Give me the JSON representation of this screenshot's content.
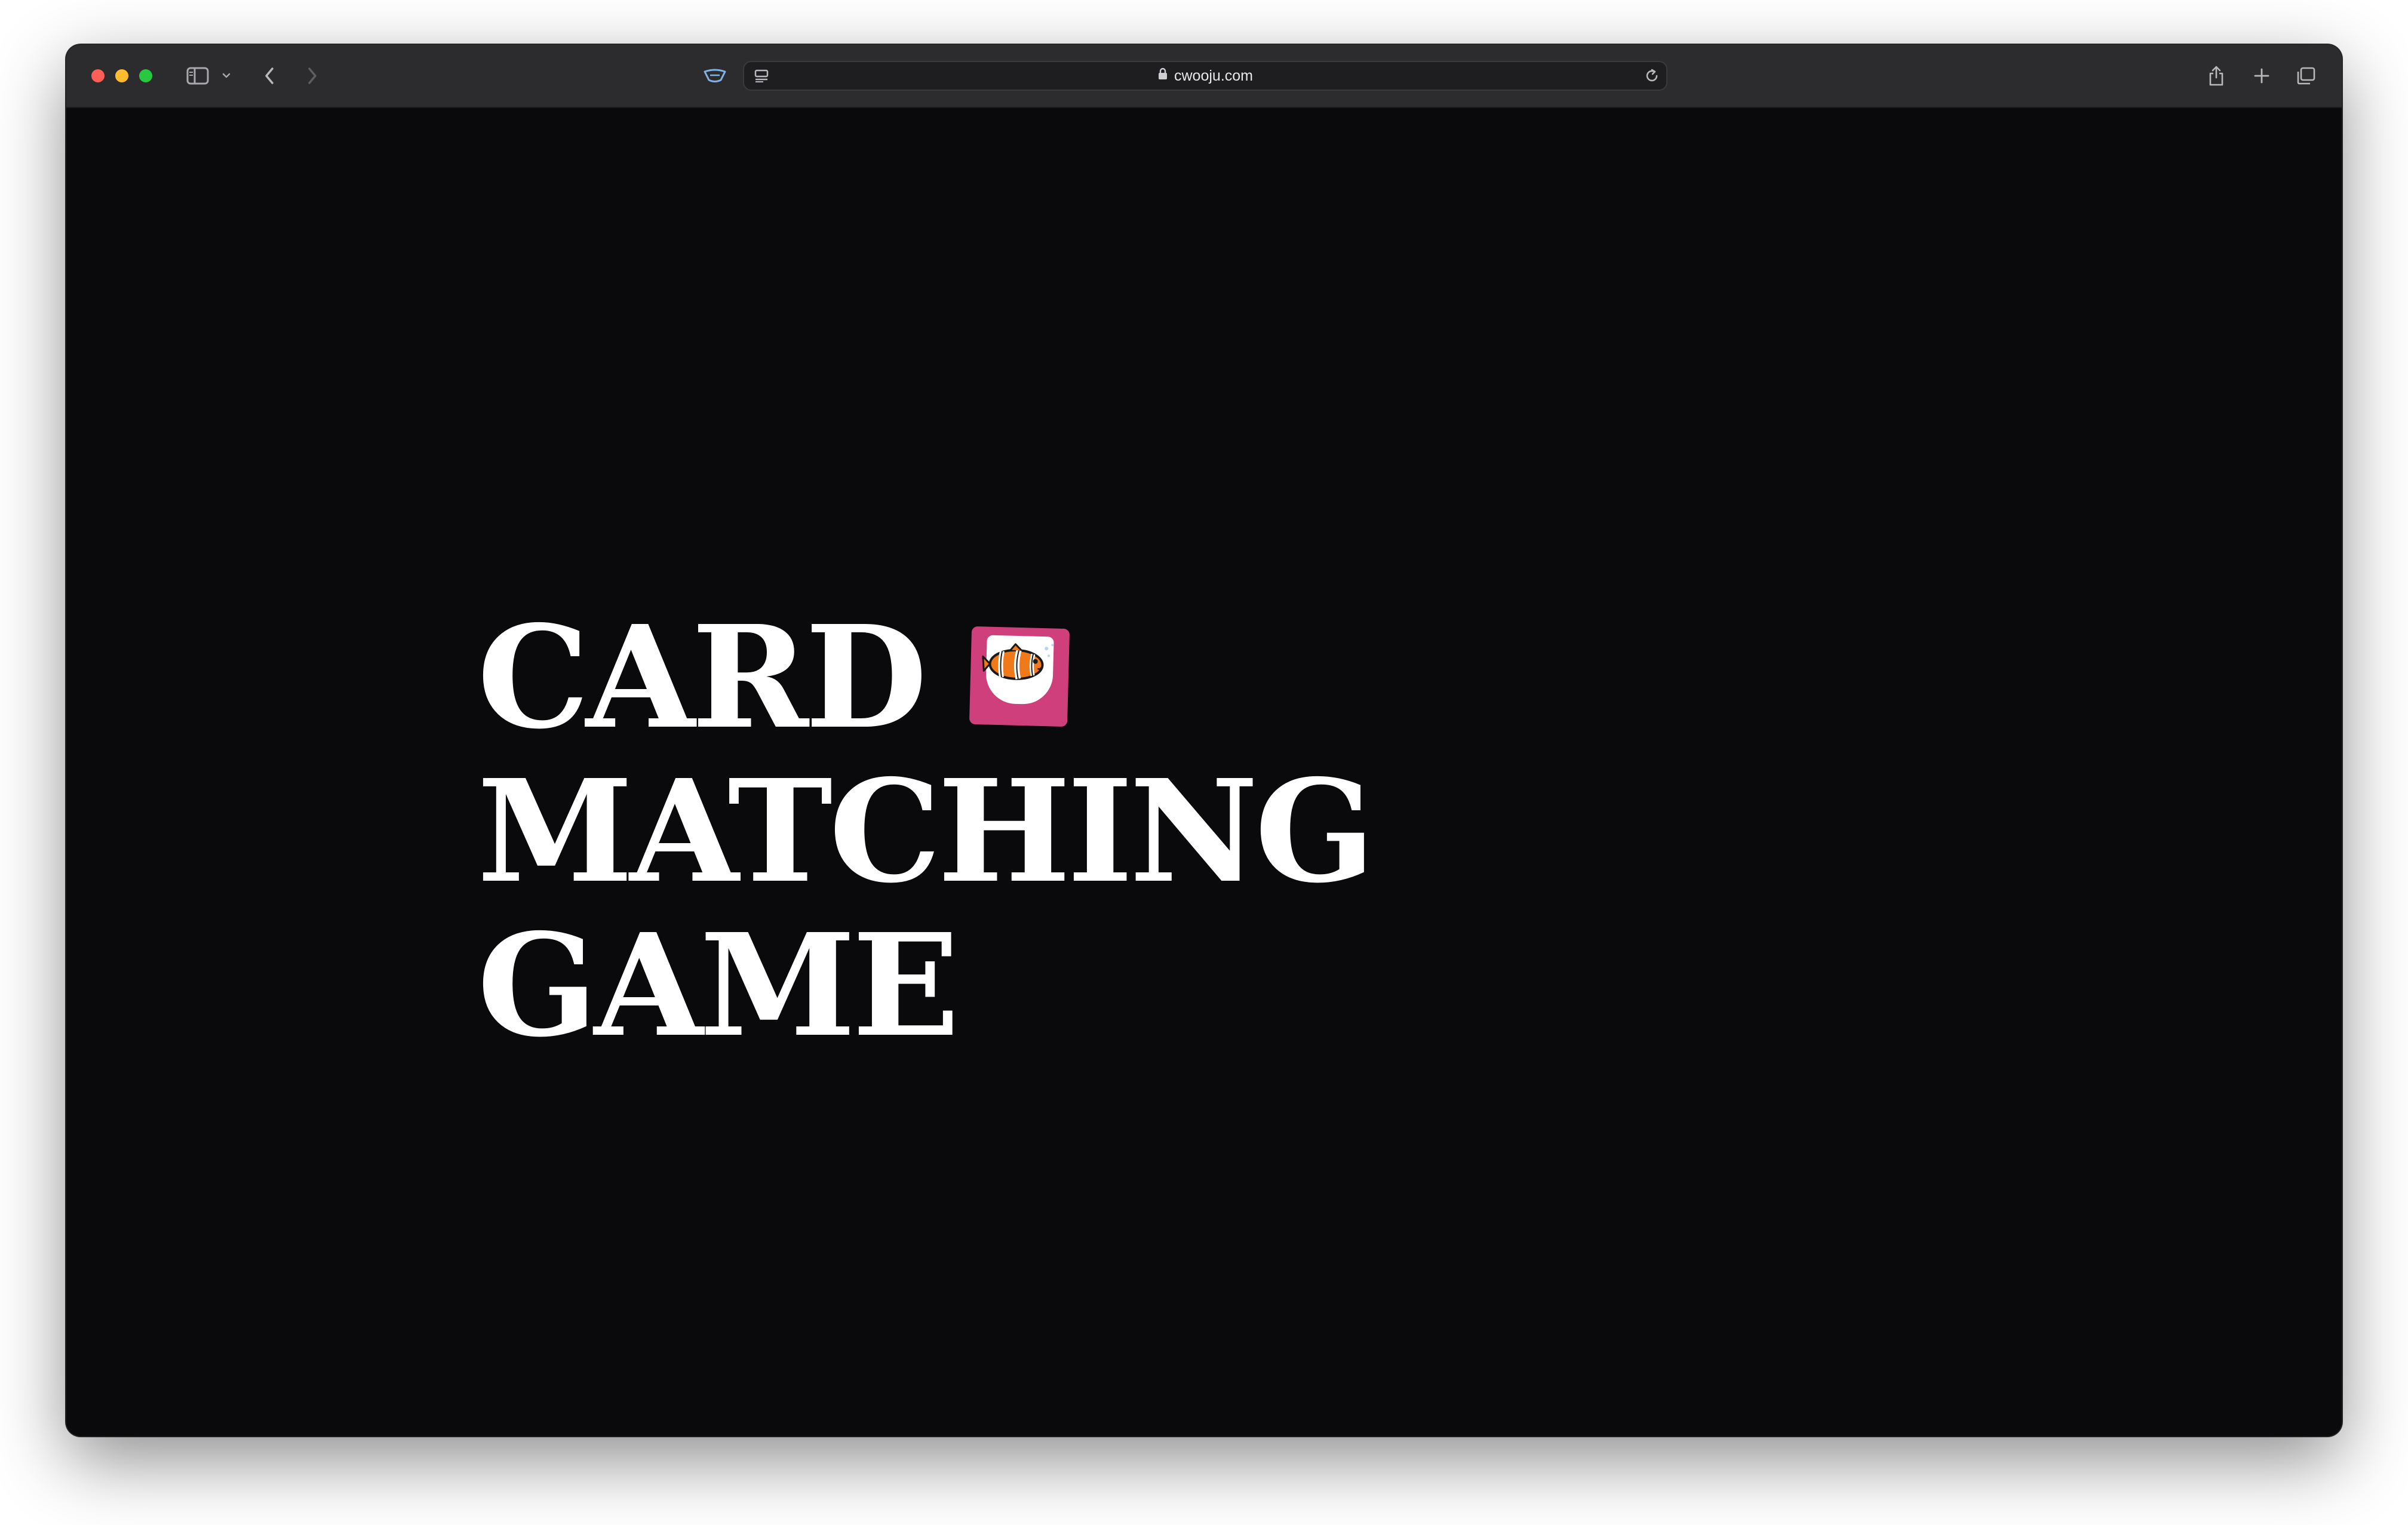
{
  "browser": {
    "url": "cwooju.com",
    "colors": {
      "close": "#ff5f57",
      "minimize": "#febc2e",
      "maximize": "#28c840",
      "toolbar": "#2c2c2e",
      "page_background": "#0a0a0c"
    },
    "icons": {
      "sidebar": "sidebar-icon",
      "tab_overview_menu": "chevron-down-icon",
      "back": "chevron-left-icon",
      "forward": "chevron-right-icon",
      "privacy": "privacy-shield-icon",
      "page_menu": "page-menu-icon",
      "lock": "lock-icon",
      "reload": "reload-icon",
      "share": "share-icon",
      "new_tab": "plus-icon",
      "tab_overview": "tabs-icon"
    }
  },
  "page": {
    "title_lines": [
      "CARD",
      "MATCHING",
      "GAME"
    ],
    "card_icon": "clownfish-card-icon",
    "card_color": "#cf3f7b"
  }
}
